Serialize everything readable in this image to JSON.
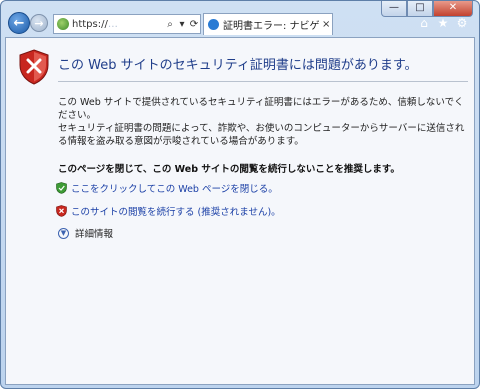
{
  "browser": {
    "caption": {
      "minimize": "—",
      "maximize": "□",
      "close": "✕"
    },
    "back_icon": "back-arrow-icon",
    "forward_icon": "forward-arrow-icon",
    "address": {
      "url_prefix": "https://",
      "url_rest": "…",
      "search_glyph": "⌕",
      "dropdown_glyph": "▾",
      "refresh_glyph": "⟳"
    },
    "tab": {
      "title": "証明書エラー: ナビゲーシ...",
      "close_glyph": "×"
    },
    "tools": {
      "home_glyph": "⌂",
      "favorites_glyph": "★",
      "settings_glyph": "⚙"
    }
  },
  "page": {
    "heading": "この Web サイトのセキュリティ証明書には問題があります。",
    "paragraph1": "この Web サイトで提供されているセキュリティ証明書にはエラーがあるため、信頼しないでください。",
    "paragraph2": "セキュリティ証明書の問題によって、詐欺や、お使いのコンピューターからサーバーに送信される情報を盗み取る意図が示唆されている場合があります。",
    "recommendation": "このページを閉じて、この Web サイトの閲覧を続行しないことを推奨します。",
    "links": {
      "close_page": "ここをクリックしてこの Web ページを閉じる。",
      "continue": "このサイトの閲覧を続行する (推奨されません)。"
    },
    "details": "詳細情報"
  },
  "colors": {
    "heading": "#1f3d8a",
    "link": "#1a3fa6",
    "shield_red": "#c8271f",
    "shield_green": "#3d9b35"
  }
}
